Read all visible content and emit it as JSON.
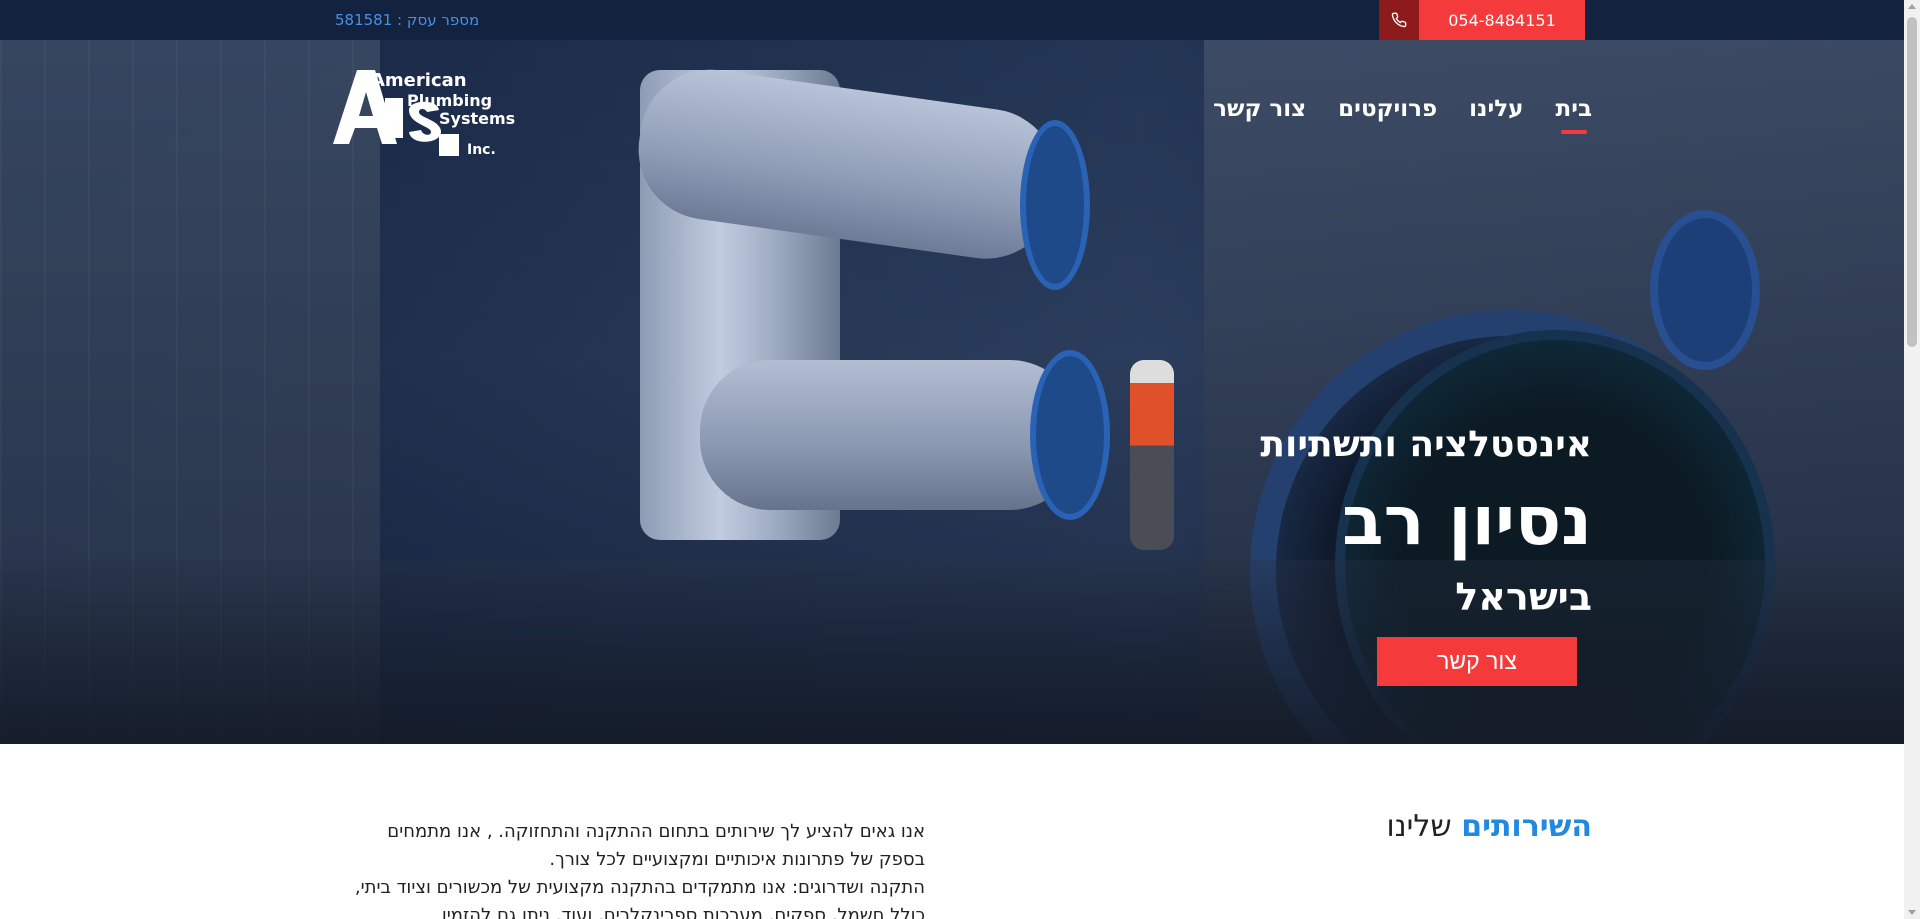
{
  "topbar": {
    "business_number": "מספר עסק : 581581",
    "phone_number": "054-8484151",
    "phone_icon": "phone-icon"
  },
  "logo": {
    "line1": "American",
    "line2": "Plumbing",
    "line3": "Systems",
    "line4": "Inc.",
    "letters": "APS"
  },
  "nav": {
    "items": [
      {
        "label": "בית",
        "active": true
      },
      {
        "label": "עלינו",
        "active": false
      },
      {
        "label": "פרויקטים",
        "active": false
      },
      {
        "label": "צור קשר",
        "active": false
      }
    ]
  },
  "hero": {
    "line1": "אינסטלציה ותשתיות",
    "line2": "נסיון רב",
    "line3": "בישראל",
    "button_label": "צור קשר"
  },
  "services": {
    "title_highlight": "השירותים",
    "title_rest": " שלינו",
    "paragraph1": "אנו גאים להציע לך שירותים בתחום ההתקנה והתחזוקה. , אנו מתמחים בספק של פתרונות איכותיים ומקצועיים לכל צורך.",
    "paragraph2": "התקנה ושדרוגים: אנו מתמקדים בהתקנה מקצועית של מכשורים וציוד ביתי, כולל חשמל, ספקים, מערכות ספרינקלרים, ועוד. ניתן גם להזמין"
  },
  "colors": {
    "topbar_bg": "#13223f",
    "accent_red": "#f43a3a",
    "accent_blue": "#2288e0"
  }
}
